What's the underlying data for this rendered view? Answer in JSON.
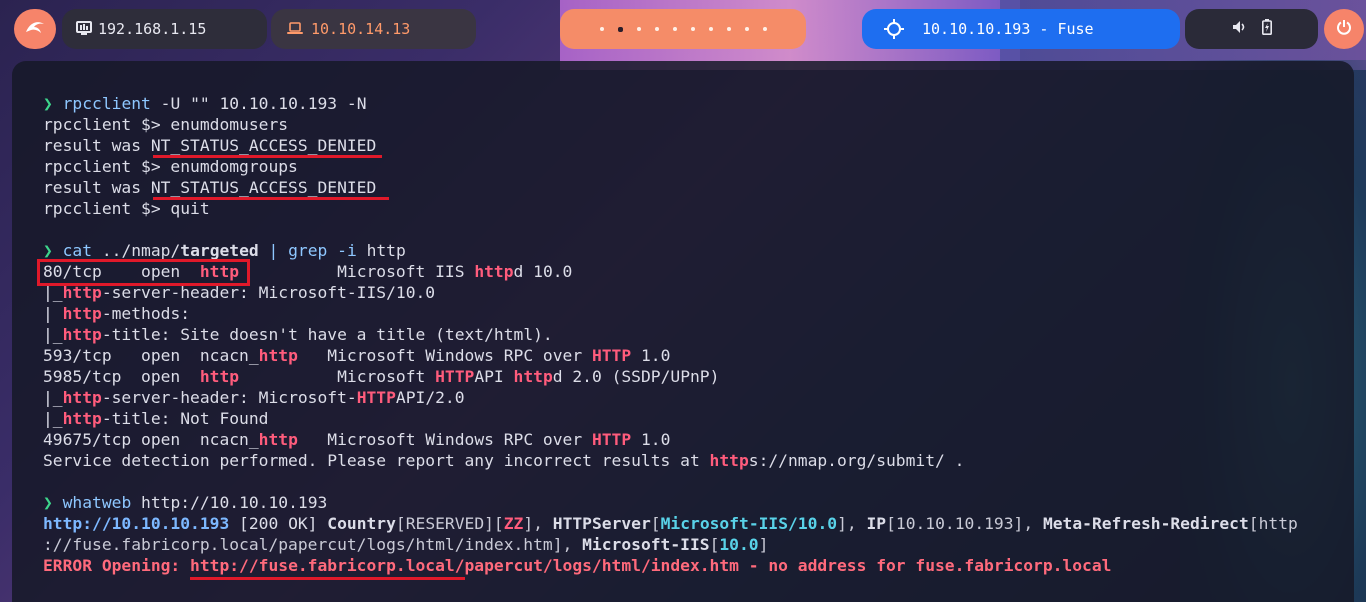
{
  "topbar": {
    "host_ip": "192.168.1.15",
    "vpn_ip": "10.10.14.13",
    "target": "10.10.10.193 - Fuse",
    "workspace_count": 10,
    "active_workspace": 1
  },
  "colors": {
    "accent": "#f6846a",
    "target_bg": "#1e6ef0",
    "highlight": "#e0192a"
  },
  "terminal": {
    "prompt_symbol": "❯",
    "block1": {
      "cmd": "rpcclient",
      "args": " -U \"\" 10.10.10.193 -N",
      "l1": "rpcclient $> enumdomusers",
      "l2a": "result was ",
      "l2b": "NT_STATUS_ACCESS_DENIED",
      "l3": "rpcclient $> enumdomgroups",
      "l4a": "result was ",
      "l4b": "NT_STATUS_ACCESS_DENIED",
      "l5": "rpcclient $> quit"
    },
    "block2": {
      "cmd1": "cat",
      "path": " ../nmap/",
      "file": "targeted",
      "pipe": " | ",
      "cmd2": "grep",
      "flag": " -i",
      "term": " http",
      "r1a": "80/tcp    open  ",
      "r1b": "http",
      "r1c": "          Microsoft IIS ",
      "r1d": "http",
      "r1e": "d 10.0",
      "r2a": "|_",
      "r2b": "http",
      "r2c": "-server-header: Microsoft-IIS/10.0",
      "r3a": "| ",
      "r3b": "http",
      "r3c": "-methods:",
      "r4a": "|_",
      "r4b": "http",
      "r4c": "-title: Site doesn't have a title (text/html).",
      "r5a": "593/tcp   open  ncacn_",
      "r5b": "http",
      "r5c": "   Microsoft Windows RPC over ",
      "r5d": "HTTP",
      "r5e": " 1.0",
      "r6a": "5985/tcp  open  ",
      "r6b": "http",
      "r6c": "          Microsoft ",
      "r6d": "HTTP",
      "r6e": "API ",
      "r6f": "http",
      "r6g": "d 2.0 (SSDP/UPnP)",
      "r7a": "|_",
      "r7b": "http",
      "r7c": "-server-header: Microsoft-",
      "r7d": "HTTP",
      "r7e": "API/2.0",
      "r8a": "|_",
      "r8b": "http",
      "r8c": "-title: Not Found",
      "r9a": "49675/tcp open  ncacn_",
      "r9b": "http",
      "r9c": "   Microsoft Windows RPC over ",
      "r9d": "HTTP",
      "r9e": " 1.0",
      "r10a": "Service detection performed. Please report any incorrect results at ",
      "r10b": "http",
      "r10c": "s://nmap.org/submit/ ."
    },
    "block3": {
      "cmd": "whatweb",
      "args": " http://10.10.10.193",
      "w1a": "http://10.10.10.193",
      "w1b": " [200 OK] ",
      "w1c": "Country",
      "w1d": "[RESERVED][",
      "w1e": "ZZ",
      "w1f": "], ",
      "w1g": "HTTPServer",
      "w1h": "[",
      "w1i": "Microsoft-IIS/10.0",
      "w1j": "], ",
      "w1k": "IP",
      "w1l": "[10.10.10.193], ",
      "w1m": "Meta-Refresh-Redirect",
      "w1n": "[http",
      "w2a": "://fuse.fabricorp.local/papercut/logs/html/index.htm], ",
      "w2b": "Microsoft-IIS",
      "w2c": "[",
      "w2d": "10.0",
      "w2e": "]",
      "e1a": "ERROR Opening: ",
      "e1b": "http://fuse.fabricorp.local/papercut/logs/html/index.htm - no address for fuse.fabricorp.local"
    }
  }
}
